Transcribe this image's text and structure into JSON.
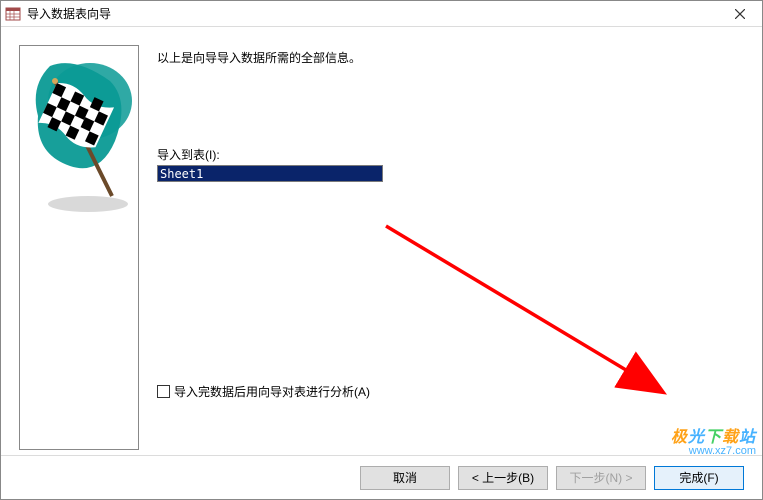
{
  "titlebar": {
    "title": "导入数据表向导"
  },
  "content": {
    "info_text": "以上是向导导入数据所需的全部信息。",
    "import_to_label": "导入到表(I):",
    "import_to_value": "Sheet1",
    "analyze_checkbox_label": "导入完数据后用向导对表进行分析(A)"
  },
  "buttons": {
    "cancel": "取消",
    "back": "< 上一步(B)",
    "next": "下一步(N) >",
    "finish": "完成(F)"
  },
  "watermark": {
    "brand": "极光下载站",
    "url": "www.xz7.com"
  }
}
